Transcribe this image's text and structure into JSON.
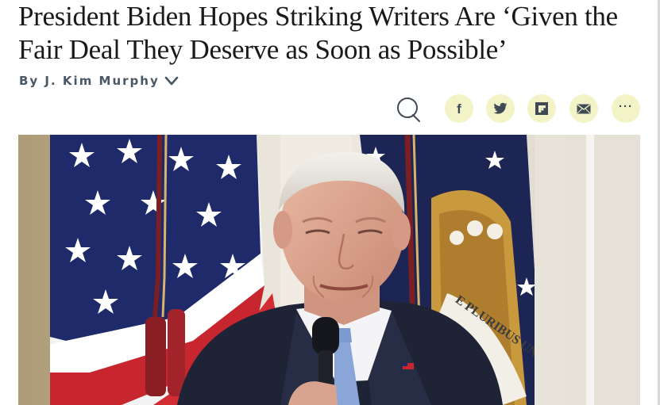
{
  "article": {
    "headline": "President Biden Hopes Striking Writers Are ‘Given the Fair Deal They Deserve as Soon as Possible’",
    "byline": "By J. Kim Murphy"
  },
  "share": {
    "icons": [
      "comment-icon",
      "facebook-icon",
      "twitter-icon",
      "flipboard-icon",
      "email-icon",
      "more-icon"
    ],
    "facebook_glyph": "f",
    "more_glyph": "···"
  },
  "photo": {
    "flag_text": "E PLURIBUS UNU"
  },
  "colors": {
    "accent": "#f2f4c8",
    "icon": "#3f4a55",
    "byline": "#4a5866",
    "headline": "#1a1a1a"
  }
}
